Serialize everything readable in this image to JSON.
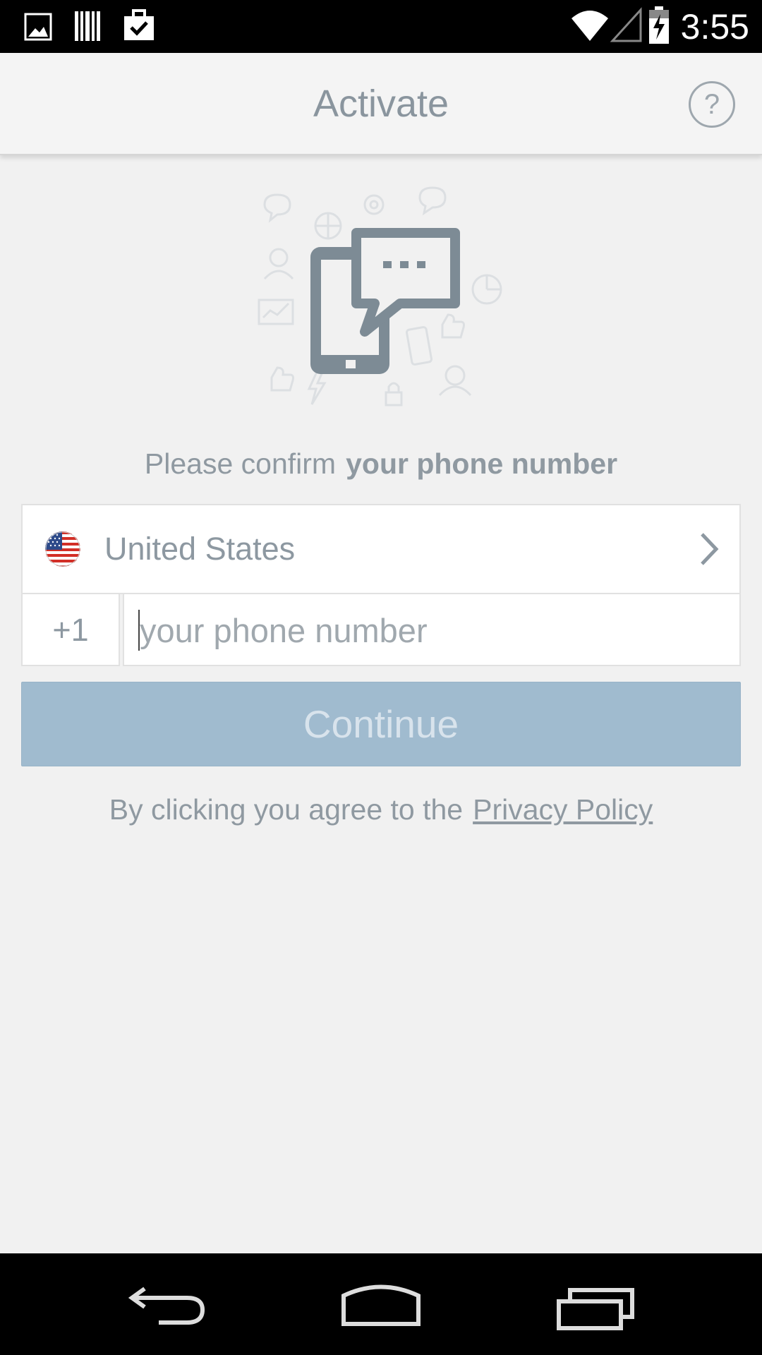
{
  "status_bar": {
    "time": "3:55",
    "notification_icons": [
      "image-icon",
      "barcode-icon",
      "briefcase-check-icon"
    ],
    "system_icons": [
      "wifi-icon",
      "signal-icon",
      "battery-charging-icon"
    ]
  },
  "app_bar": {
    "title": "Activate",
    "help_label": "?"
  },
  "hero": {
    "icon": "phone-chat-illustration"
  },
  "prompt": {
    "text": "Please confirm",
    "bold": "your phone number"
  },
  "country_selector": {
    "flag_icon": "us-flag-icon",
    "name": "United States"
  },
  "phone": {
    "dial_code": "+1",
    "value": "",
    "placeholder": "your phone number"
  },
  "continue_button": {
    "label": "Continue",
    "enabled": false
  },
  "agreement": {
    "text": "By clicking you agree to the",
    "link_label": "Privacy Policy"
  },
  "nav_bar": {
    "buttons": [
      "back-icon",
      "home-icon",
      "recents-icon"
    ]
  },
  "colors": {
    "background": "#f1f1f1",
    "primary_text": "#8d98a1",
    "button_disabled": "#a0bbcf",
    "button_text_disabled": "#d8e3ec",
    "illustration_gray": "#7d8b95"
  }
}
